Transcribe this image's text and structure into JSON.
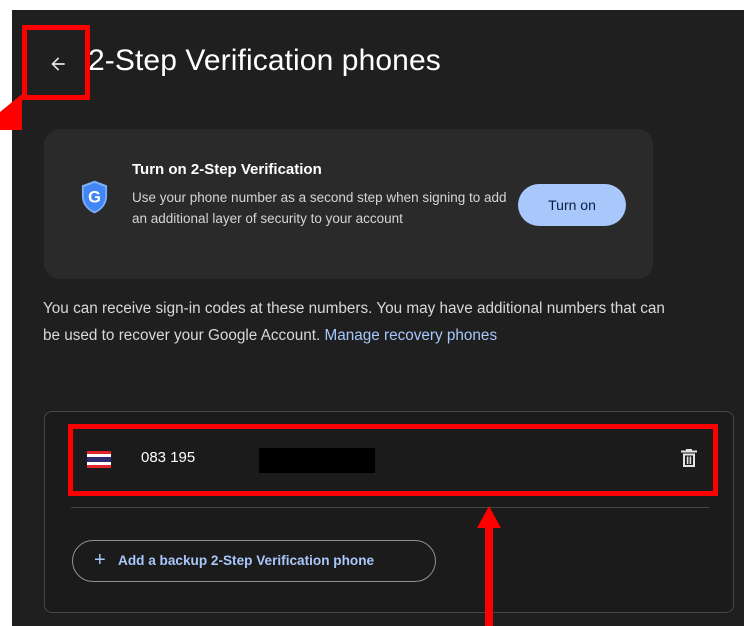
{
  "header": {
    "title": "2-Step Verification phones",
    "back_icon": "arrow-left-icon"
  },
  "promo": {
    "title": "Turn on 2-Step Verification",
    "text": "Use your phone number as a second step when signing to add an additional layer of security to your account",
    "button_label": "Turn on",
    "icon": "google-shield-icon"
  },
  "info": {
    "text": "You can receive sign-in codes at these numbers. You may have additional numbers that can be used to recover your Google Account.",
    "link": "Manage recovery phones"
  },
  "phones": {
    "items": [
      {
        "flag": "thailand-flag-icon",
        "number": "083 195",
        "delete_icon": "trash-icon"
      }
    ],
    "add_button_label": "Add a backup 2-Step Verification phone",
    "add_icon": "plus-icon"
  },
  "colors": {
    "background": "#1f1f1f",
    "card": "#2a2a2a",
    "accent": "#a8c7fa",
    "annotation": "#ff0000"
  }
}
